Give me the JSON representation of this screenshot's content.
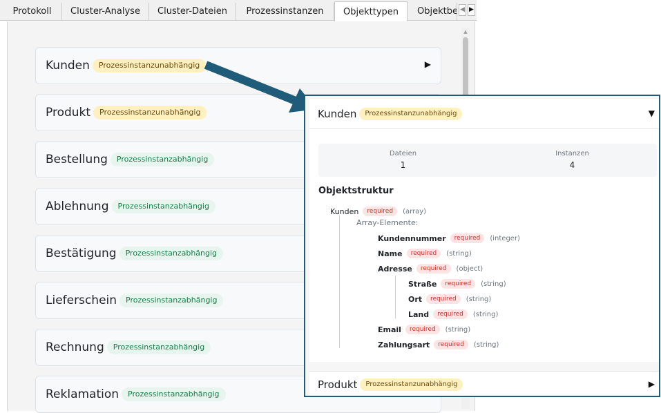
{
  "tabs": [
    {
      "label": "Protokoll",
      "active": false
    },
    {
      "label": "Cluster-Analyse",
      "active": false
    },
    {
      "label": "Cluster-Dateien",
      "active": false
    },
    {
      "label": "Prozessinstanzen",
      "active": false
    },
    {
      "label": "Objekttypen",
      "active": true
    },
    {
      "label": "Objektbe",
      "active": false
    }
  ],
  "tab_scroll": {
    "left_icon": "◀",
    "right_icon": "▶"
  },
  "cards": [
    {
      "title": "Kunden",
      "badge": "Prozessinstanzunabhängig",
      "badge_kind": "independent",
      "arrow": "▶"
    },
    {
      "title": "Produkt",
      "badge": "Prozessinstanzunabhängig",
      "badge_kind": "independent"
    },
    {
      "title": "Bestellung",
      "badge": "Prozessinstanzabhängig",
      "badge_kind": "dependent"
    },
    {
      "title": "Ablehnung",
      "badge": "Prozessinstanzabhängig",
      "badge_kind": "dependent"
    },
    {
      "title": "Bestätigung",
      "badge": "Prozessinstanzabhängig",
      "badge_kind": "dependent"
    },
    {
      "title": "Lieferschein",
      "badge": "Prozessinstanzabhängig",
      "badge_kind": "dependent"
    },
    {
      "title": "Rechnung",
      "badge": "Prozessinstanzabhängig",
      "badge_kind": "dependent"
    },
    {
      "title": "Reklamation",
      "badge": "Prozessinstanzabhängig",
      "badge_kind": "dependent"
    }
  ],
  "detail": {
    "title": "Kunden",
    "badge": "Prozessinstanzunabhängig",
    "toggle": "▼",
    "stats": {
      "files_label": "Dateien",
      "files_value": "1",
      "instances_label": "Instanzen",
      "instances_value": "4"
    },
    "section_title": "Objektstruktur",
    "structure": {
      "root": {
        "name": "Kunden",
        "req": "required",
        "type": "(array)"
      },
      "array_label": "Array-Elemente:",
      "fields": [
        {
          "name": "Kundennummer",
          "req": "required",
          "type": "(integer)"
        },
        {
          "name": "Name",
          "req": "required",
          "type": "(string)"
        },
        {
          "name": "Adresse",
          "req": "required",
          "type": "(object)"
        },
        {
          "name": "Straße",
          "req": "required",
          "type": "(string)"
        },
        {
          "name": "Ort",
          "req": "required",
          "type": "(string)"
        },
        {
          "name": "Land",
          "req": "required",
          "type": "(string)"
        },
        {
          "name": "Email",
          "req": "required",
          "type": "(string)"
        },
        {
          "name": "Zahlungsart",
          "req": "required",
          "type": "(string)"
        }
      ]
    },
    "next": {
      "title": "Produkt",
      "badge": "Prozessinstanzunabhängig",
      "arrow": "▶"
    }
  },
  "colors": {
    "accent_arrow": "#1f5c7a",
    "badge_independent_bg": "#fff0c2",
    "badge_dependent_bg": "#e7f5ee",
    "required_bg": "#fde4e4"
  }
}
